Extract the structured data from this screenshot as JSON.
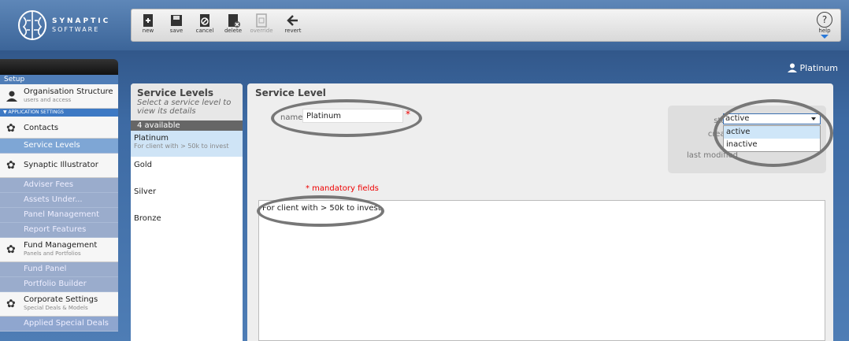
{
  "brand": {
    "line1": "SYNAPTIC",
    "line2": "SOFTWARE"
  },
  "toolbar": {
    "new": "new",
    "save": "save",
    "cancel": "cancel",
    "delete": "delete",
    "override": "override",
    "revert": "revert",
    "help": "help"
  },
  "user": {
    "name": "Platinum"
  },
  "sidebar": {
    "section": "Setup",
    "org_title": "Organisation Structure",
    "org_sub": "users and access",
    "app_settings": "▼ APPLICATION SETTINGS",
    "contacts": "Contacts",
    "service_levels": "Service Levels",
    "illustrator": "Synaptic Illustrator",
    "illustrator_items": [
      "Adviser Fees",
      "Assets Under...",
      "Panel Management",
      "Report Features"
    ],
    "fund_title": "Fund Management",
    "fund_sub": "Panels and Portfolios",
    "fund_items": [
      "Fund Panel",
      "Portfolio Builder"
    ],
    "corp_title": "Corporate Settings",
    "corp_sub": "Special Deals & Models",
    "applied": "Applied Special Deals"
  },
  "list": {
    "title": "Service Levels",
    "subtitle": "Select a service level to view its details",
    "count": "4 available",
    "items": [
      {
        "name": "Platinum",
        "desc": "For client with > 50k to invest"
      },
      {
        "name": "Gold",
        "desc": ""
      },
      {
        "name": "Silver",
        "desc": ""
      },
      {
        "name": "Bronze",
        "desc": ""
      }
    ]
  },
  "form": {
    "title": "Service Level",
    "name_label": "name",
    "name_value": "Platinum",
    "required_mark": "*",
    "status_label": "status",
    "status_value": "active",
    "status_options": [
      "active",
      "inactive"
    ],
    "created_label": "created",
    "modified_label": "last modified",
    "mandatory": "* mandatory fields",
    "description": "For client with > 50k to invest"
  },
  "colors": {
    "accent": "#3d79c4",
    "selected": "#cfe4f6",
    "required": "#e00000"
  }
}
